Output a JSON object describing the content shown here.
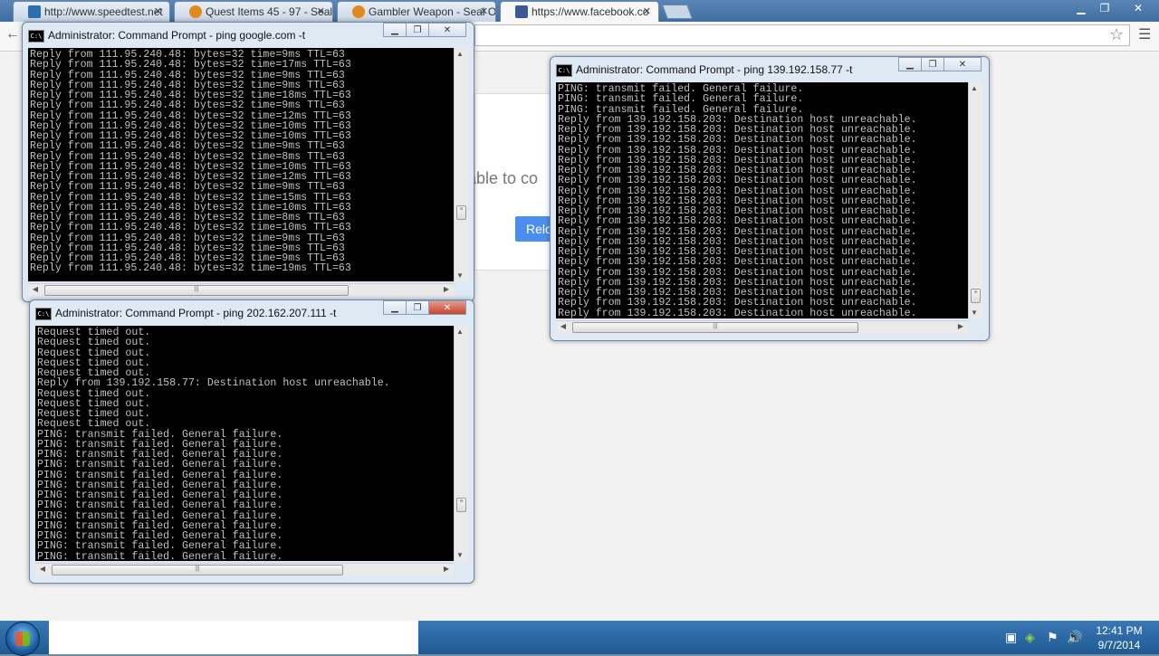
{
  "browser": {
    "tabs": [
      {
        "title": "http://www.speedtest.net"
      },
      {
        "title": "Quest Items 45 - 97 - Seal"
      },
      {
        "title": "Gambler Weapon - Seal O"
      },
      {
        "title": "https://www.facebook.co"
      }
    ],
    "close_glyph": "✕",
    "page": {
      "error_text_fragment": "able to co",
      "reload_label_fragment": "Relo"
    }
  },
  "windows": {
    "google": {
      "title": "Administrator: Command Prompt - ping  google.com -t",
      "lines": [
        "Reply from 111.95.240.48: bytes=32 time=9ms TTL=63",
        "Reply from 111.95.240.48: bytes=32 time=17ms TTL=63",
        "Reply from 111.95.240.48: bytes=32 time=9ms TTL=63",
        "Reply from 111.95.240.48: bytes=32 time=9ms TTL=63",
        "Reply from 111.95.240.48: bytes=32 time=18ms TTL=63",
        "Reply from 111.95.240.48: bytes=32 time=9ms TTL=63",
        "Reply from 111.95.240.48: bytes=32 time=12ms TTL=63",
        "Reply from 111.95.240.48: bytes=32 time=10ms TTL=63",
        "Reply from 111.95.240.48: bytes=32 time=10ms TTL=63",
        "Reply from 111.95.240.48: bytes=32 time=9ms TTL=63",
        "Reply from 111.95.240.48: bytes=32 time=8ms TTL=63",
        "Reply from 111.95.240.48: bytes=32 time=10ms TTL=63",
        "Reply from 111.95.240.48: bytes=32 time=12ms TTL=63",
        "Reply from 111.95.240.48: bytes=32 time=9ms TTL=63",
        "Reply from 111.95.240.48: bytes=32 time=15ms TTL=63",
        "Reply from 111.95.240.48: bytes=32 time=10ms TTL=63",
        "Reply from 111.95.240.48: bytes=32 time=8ms TTL=63",
        "Reply from 111.95.240.48: bytes=32 time=10ms TTL=63",
        "Reply from 111.95.240.48: bytes=32 time=9ms TTL=63",
        "Reply from 111.95.240.48: bytes=32 time=9ms TTL=63",
        "Reply from 111.95.240.48: bytes=32 time=9ms TTL=63",
        "Reply from 111.95.240.48: bytes=32 time=19ms TTL=63"
      ]
    },
    "ip202": {
      "title": "Administrator: Command Prompt - ping  202.162.207.111 -t",
      "lines": [
        "Request timed out.",
        "Request timed out.",
        "Request timed out.",
        "Request timed out.",
        "Request timed out.",
        "Reply from 139.192.158.77: Destination host unreachable.",
        "Request timed out.",
        "Request timed out.",
        "Request timed out.",
        "Request timed out.",
        "PING: transmit failed. General failure.",
        "PING: transmit failed. General failure.",
        "PING: transmit failed. General failure.",
        "PING: transmit failed. General failure.",
        "PING: transmit failed. General failure.",
        "PING: transmit failed. General failure.",
        "PING: transmit failed. General failure.",
        "PING: transmit failed. General failure.",
        "PING: transmit failed. General failure.",
        "PING: transmit failed. General failure.",
        "PING: transmit failed. General failure.",
        "PING: transmit failed. General failure.",
        "PING: transmit failed. General failure."
      ]
    },
    "ip139": {
      "title": "Administrator: Command Prompt - ping  139.192.158.77 -t",
      "lines": [
        "PING: transmit failed. General failure.",
        "PING: transmit failed. General failure.",
        "PING: transmit failed. General failure.",
        "Reply from 139.192.158.203: Destination host unreachable.",
        "Reply from 139.192.158.203: Destination host unreachable.",
        "Reply from 139.192.158.203: Destination host unreachable.",
        "Reply from 139.192.158.203: Destination host unreachable.",
        "Reply from 139.192.158.203: Destination host unreachable.",
        "Reply from 139.192.158.203: Destination host unreachable.",
        "Reply from 139.192.158.203: Destination host unreachable.",
        "Reply from 139.192.158.203: Destination host unreachable.",
        "Reply from 139.192.158.203: Destination host unreachable.",
        "Reply from 139.192.158.203: Destination host unreachable.",
        "Reply from 139.192.158.203: Destination host unreachable.",
        "Reply from 139.192.158.203: Destination host unreachable.",
        "Reply from 139.192.158.203: Destination host unreachable.",
        "Reply from 139.192.158.203: Destination host unreachable.",
        "Reply from 139.192.158.203: Destination host unreachable.",
        "Reply from 139.192.158.203: Destination host unreachable.",
        "Reply from 139.192.158.203: Destination host unreachable.",
        "Reply from 139.192.158.203: Destination host unreachable.",
        "Reply from 139.192.158.203: Destination host unreachable.",
        "Reply from 139.192.158.203: Destination host unreachable."
      ]
    }
  },
  "taskbar": {
    "time": "12:41 PM",
    "date": "9/7/2014"
  }
}
